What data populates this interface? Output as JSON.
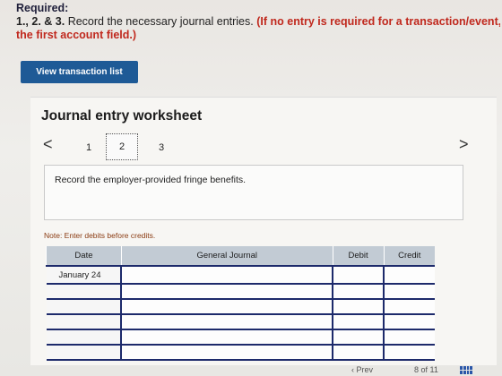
{
  "required": {
    "heading": "Required:",
    "nums": "1., 2. & 3.",
    "instruction": "Record the necessary journal entries.",
    "note_line1": "(If no entry is required for a transaction/event, se",
    "note_line2": "the first account field.)"
  },
  "view_button": "View transaction list",
  "worksheet": {
    "title": "Journal entry worksheet",
    "prev": "<",
    "next": ">",
    "tabs": [
      "1",
      "2",
      "3"
    ],
    "active_tab": "2",
    "instruction": "Record the employer-provided fringe benefits.",
    "note": "Note: Enter debits before credits."
  },
  "journal": {
    "headers": [
      "Date",
      "General Journal",
      "Debit",
      "Credit"
    ],
    "rows": [
      {
        "date": "January 24",
        "account": "",
        "debit": "",
        "credit": ""
      },
      {
        "date": "",
        "account": "",
        "debit": "",
        "credit": ""
      },
      {
        "date": "",
        "account": "",
        "debit": "",
        "credit": ""
      },
      {
        "date": "",
        "account": "",
        "debit": "",
        "credit": ""
      },
      {
        "date": "",
        "account": "",
        "debit": "",
        "credit": ""
      },
      {
        "date": "",
        "account": "",
        "debit": "",
        "credit": ""
      }
    ]
  },
  "footer": {
    "prev": "‹ Prev",
    "page": "8 of 11",
    "grid_icon": "grid-icon"
  }
}
